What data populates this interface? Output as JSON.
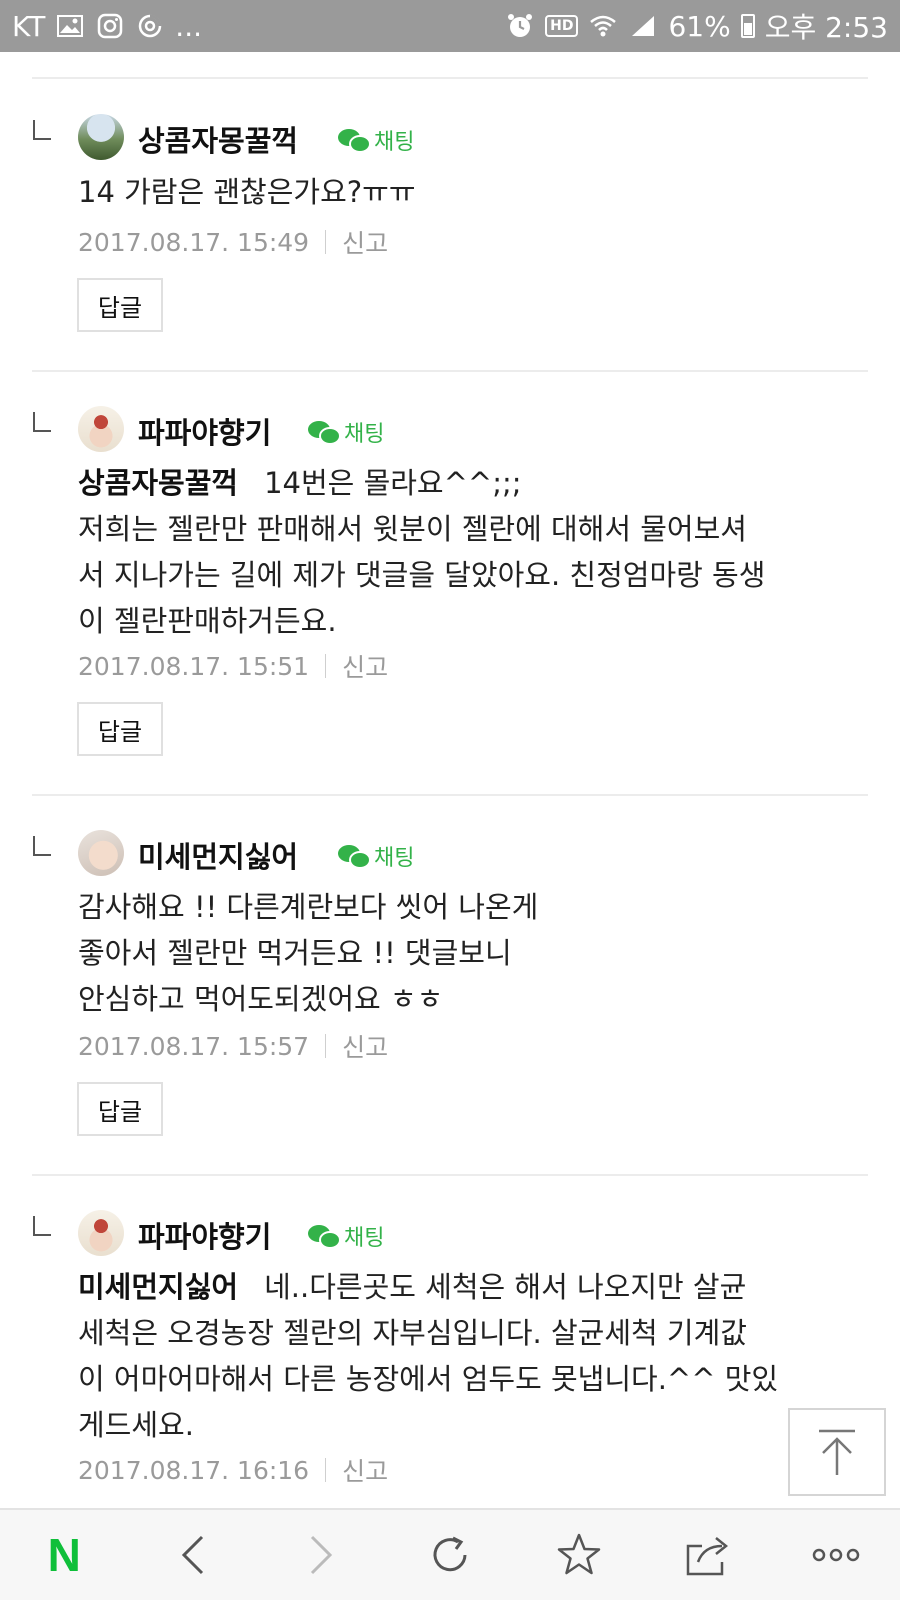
{
  "status_bar": {
    "carrier": "KT",
    "more": "...",
    "hd": "HD",
    "battery": "61%",
    "time": "오후 2:53"
  },
  "chat_label": "채팅",
  "comments": [
    {
      "author": "상콤자몽꿀꺽",
      "mention": "",
      "lines": [
        "14 가람은 괜찮은가요?ㅠㅠ"
      ],
      "date": "2017.08.17. 15:49",
      "report": "신고",
      "reply": "답글"
    },
    {
      "author": "파파야향기",
      "mention": "상콤자몽꿀꺽",
      "lines": [
        "14번은 몰라요^^;;;",
        "저희는 젤란만 판매해서 윗분이 젤란에 대해서 물어보셔",
        "서 지나가는 길에 제가 댓글을 달았아요. 친정엄마랑 동생",
        "이 젤란판매하거든요."
      ],
      "date": "2017.08.17. 15:51",
      "report": "신고",
      "reply": "답글"
    },
    {
      "author": "미세먼지싫어",
      "mention": "",
      "lines": [
        "감사해요 !! 다른계란보다 씻어 나온게",
        "좋아서 젤란만 먹거든요 !! 댓글보니",
        "안심하고 먹어도되겠어요 ㅎㅎ"
      ],
      "date": "2017.08.17. 15:57",
      "report": "신고",
      "reply": "답글"
    },
    {
      "author": "파파야향기",
      "mention": "미세먼지싫어",
      "lines": [
        "네..다른곳도 세척은 해서 나오지만 살균",
        "세척은 오경농장 젤란의 자부심입니다. 살균세척 기계값",
        "이 어마어마해서 다른 농장에서 엄두도 못냅니다.^^ 맛있",
        "게드세요."
      ],
      "date": "2017.08.17. 16:16",
      "report": "신고",
      "reply": "답글"
    }
  ],
  "toolbar": {
    "home_logo": "N",
    "icons": [
      "naver-home-icon",
      "back-icon",
      "forward-icon",
      "refresh-icon",
      "bookmark-star-icon",
      "share-icon",
      "more-icon"
    ]
  },
  "colors": {
    "accent_green": "#33b249",
    "naver_green": "#0fbf3a",
    "status_bar": "#9a9a9a",
    "meta_gray": "#9a9a9a"
  }
}
